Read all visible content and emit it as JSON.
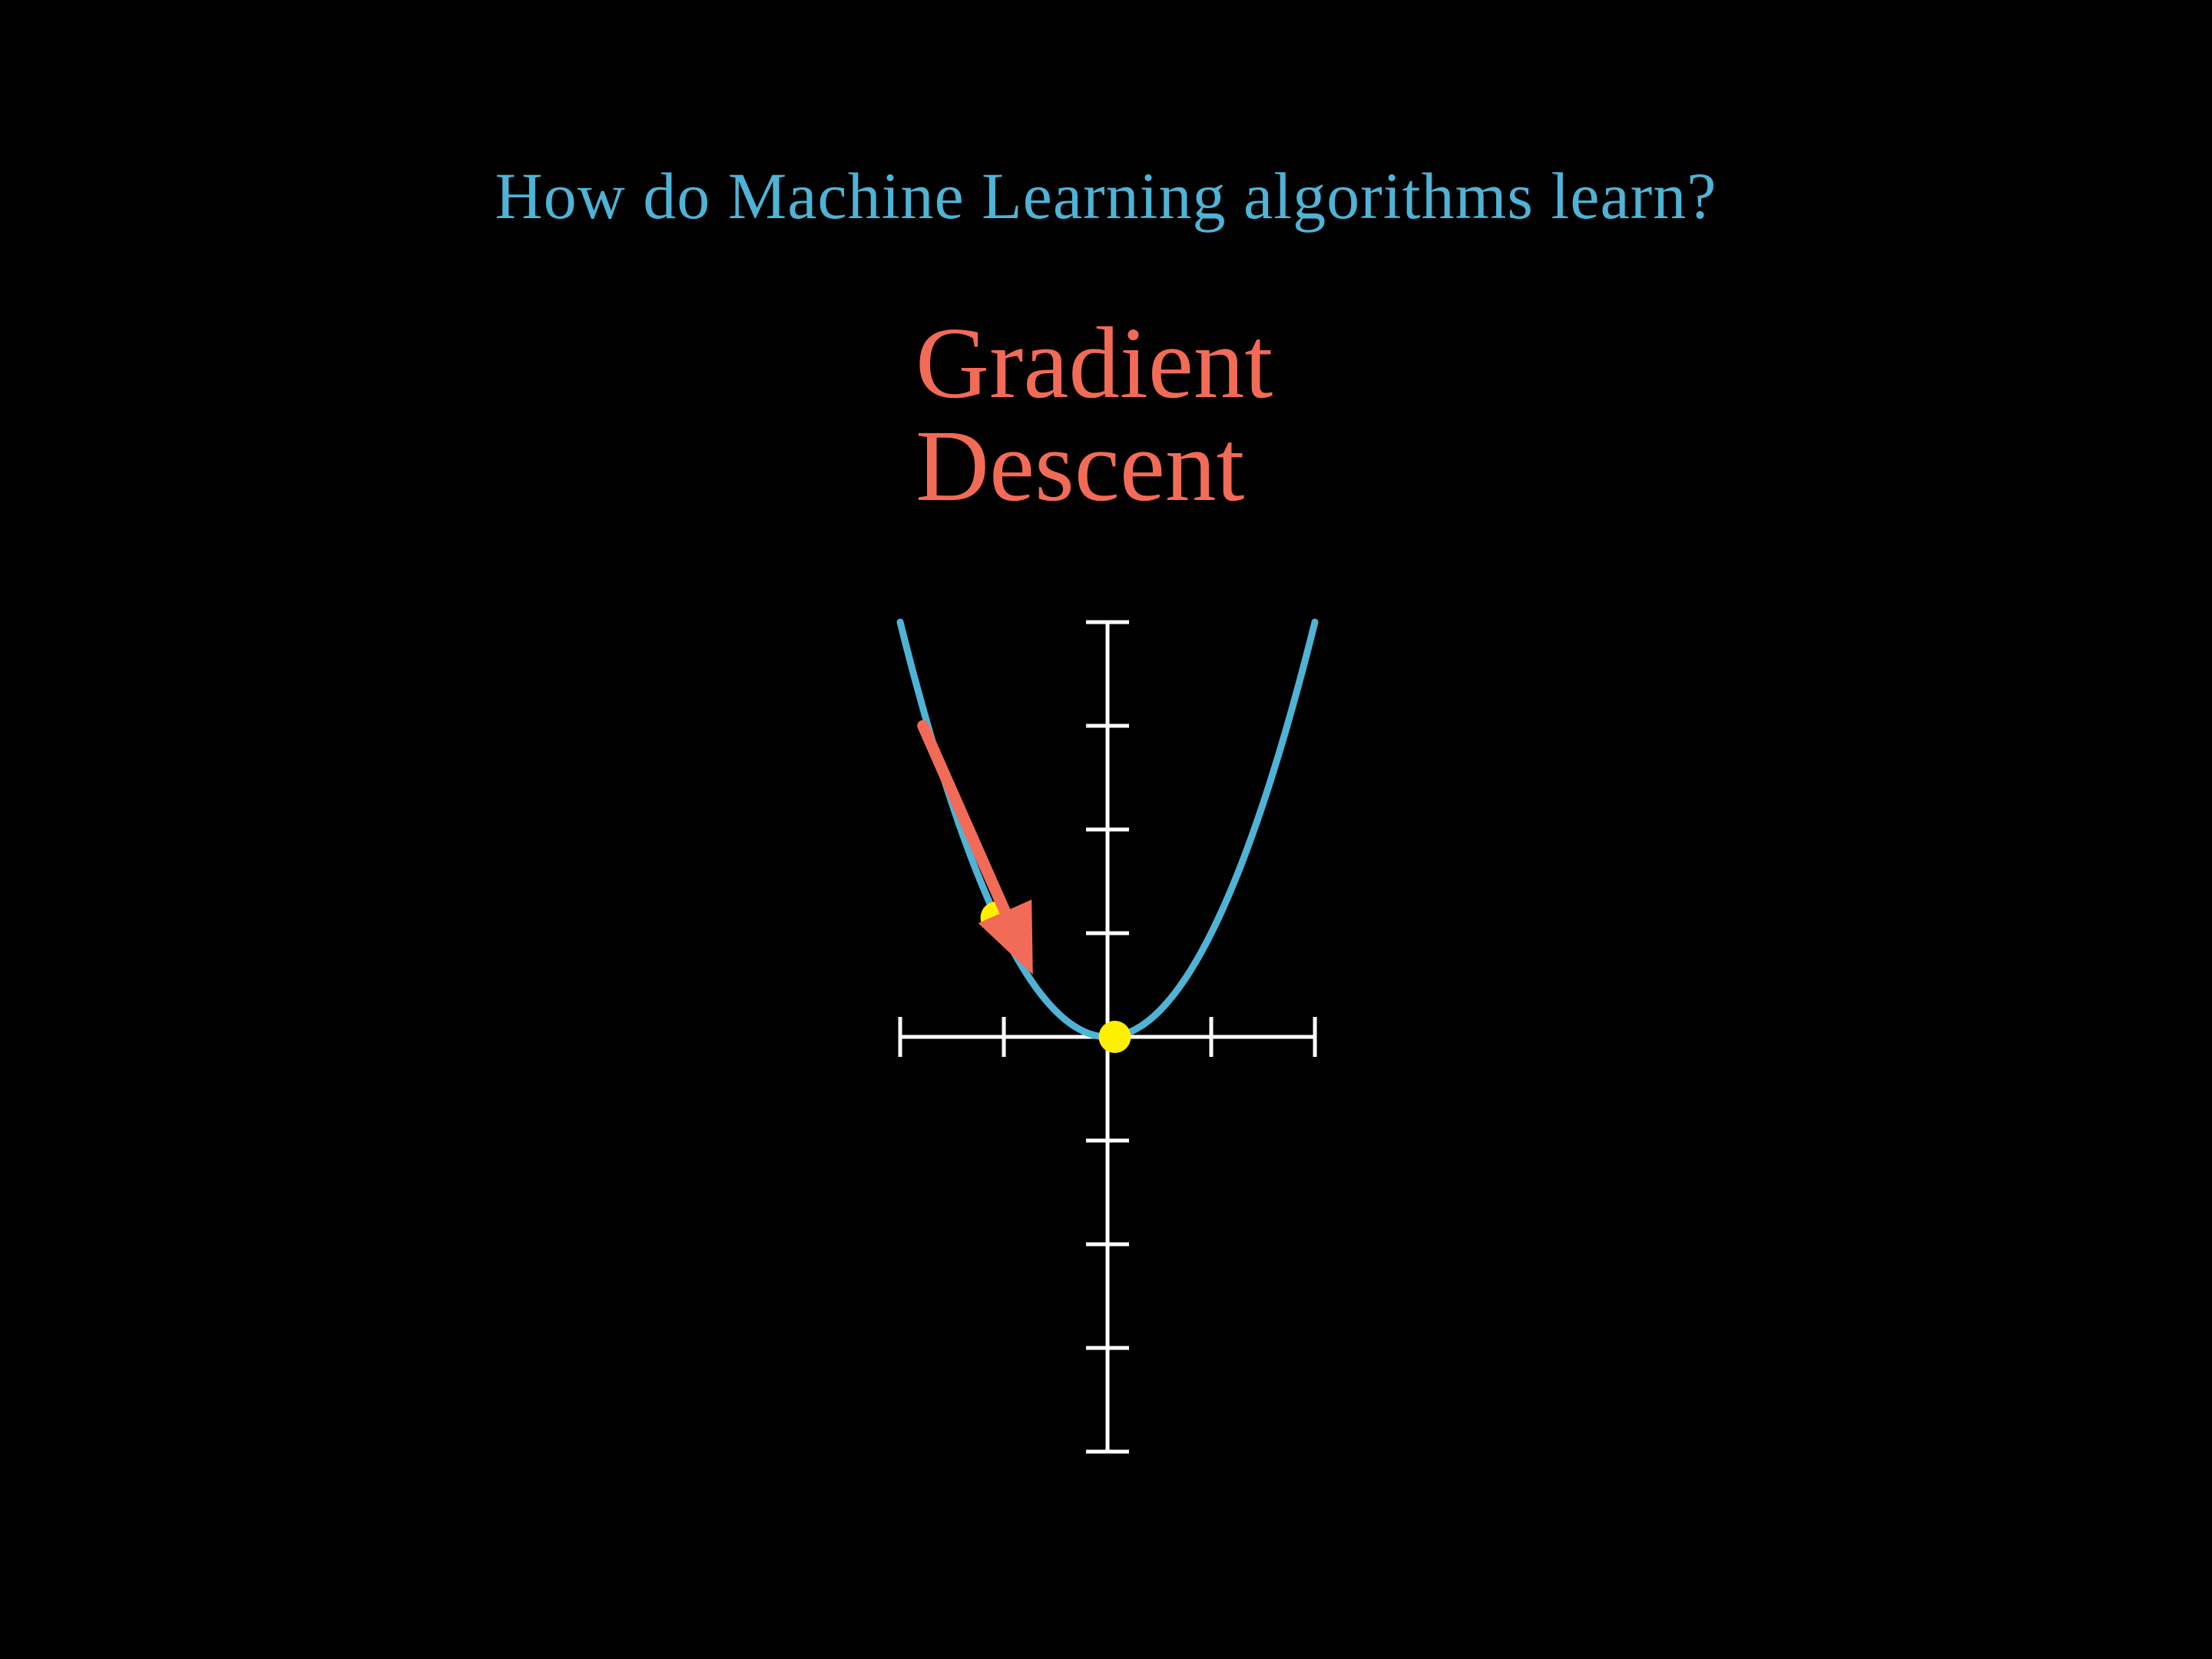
{
  "slide": {
    "question": "How do Machine Learning algorithms learn?",
    "title_line1": "Gradient",
    "title_line2": "Descent"
  },
  "colors": {
    "background": "#000000",
    "question": "#4fb3d6",
    "title": "#f26b57",
    "curve": "#4fb3d6",
    "axes": "#ffffff",
    "arrow": "#f26b57",
    "point": "#ffef00"
  },
  "chart_data": {
    "type": "line",
    "function": "y = x^2",
    "x_range": [
      -2,
      2
    ],
    "y_range": [
      -4,
      4
    ],
    "xticks": [
      -2,
      -1,
      0,
      1,
      2
    ],
    "yticks": [
      -4,
      -3,
      -2,
      -1,
      0,
      1,
      2,
      3,
      4
    ],
    "grid": false,
    "points": [
      {
        "name": "current-point",
        "x": -1.07,
        "y": 1.15
      },
      {
        "name": "minimum-point",
        "x": 0.07,
        "y": 0.0
      }
    ],
    "arrow": {
      "from": [
        -1.78,
        3.0
      ],
      "to": [
        -0.72,
        0.6
      ]
    }
  }
}
